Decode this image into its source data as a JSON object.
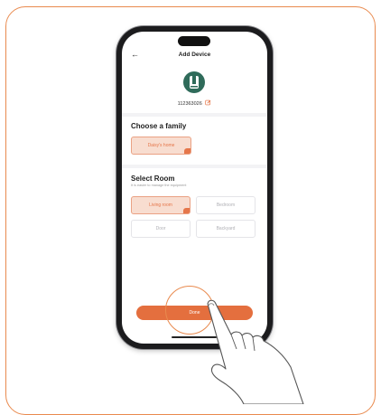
{
  "header": {
    "back_icon": "back-arrow-icon",
    "title": "Add Device"
  },
  "device": {
    "icon": "device-icon",
    "id": "112363026",
    "edit_icon": "edit-icon"
  },
  "family": {
    "title": "Choose a family",
    "options": [
      {
        "label": "Daisy's home",
        "selected": true
      }
    ]
  },
  "room": {
    "title": "Select Room",
    "hint": "It is easier to manage the equipment",
    "options": [
      {
        "label": "Living room",
        "selected": true
      },
      {
        "label": "Bedroom",
        "selected": false
      },
      {
        "label": "Door",
        "selected": false
      },
      {
        "label": "Backyard",
        "selected": false
      }
    ]
  },
  "actions": {
    "done_label": "Done"
  },
  "colors": {
    "accent": "#E46F3E",
    "frame": "#E98A4E",
    "device": "#2f6b5a"
  }
}
